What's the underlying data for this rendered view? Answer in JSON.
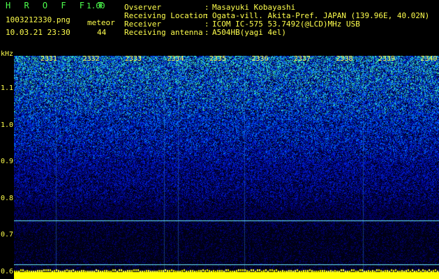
{
  "app": {
    "name": "H R O F F T",
    "version": "1.00"
  },
  "file": {
    "name": "1003212330.png",
    "datetime": "10.03.21 23:30"
  },
  "meteor": {
    "label": "meteor",
    "count": "44"
  },
  "meta": [
    {
      "key": "Ovserver",
      "value": "Masayuki Kobayashi"
    },
    {
      "key": "Receiving Location",
      "value": "Ogata-vill. Akita-Pref. JAPAN (139.96E, 40.02N)"
    },
    {
      "key": "Receiver",
      "value": "ICOM IC-575 53.7492(@LCD)MHz USB"
    },
    {
      "key": "Receiving antenna",
      "value": "A504HB(yagi 4el)"
    }
  ],
  "colors": {
    "text": "#ffff4d",
    "accent": "#4dff4d",
    "bg": "#000000",
    "line": "#6cf0ff"
  },
  "chart_data": {
    "type": "heatmap",
    "ylabel": "kHz",
    "y_ticks": [
      "1.1",
      "1.0",
      "0.9",
      "0.8",
      "0.7",
      "0.6"
    ],
    "x_ticks": [
      "2331",
      "2332",
      "2333",
      "2334",
      "2335",
      "2336",
      "2337",
      "2338",
      "2339",
      "2340"
    ],
    "ylim": [
      0.58,
      1.19
    ],
    "signal_lines_khz": [
      0.74,
      0.62
    ]
  }
}
